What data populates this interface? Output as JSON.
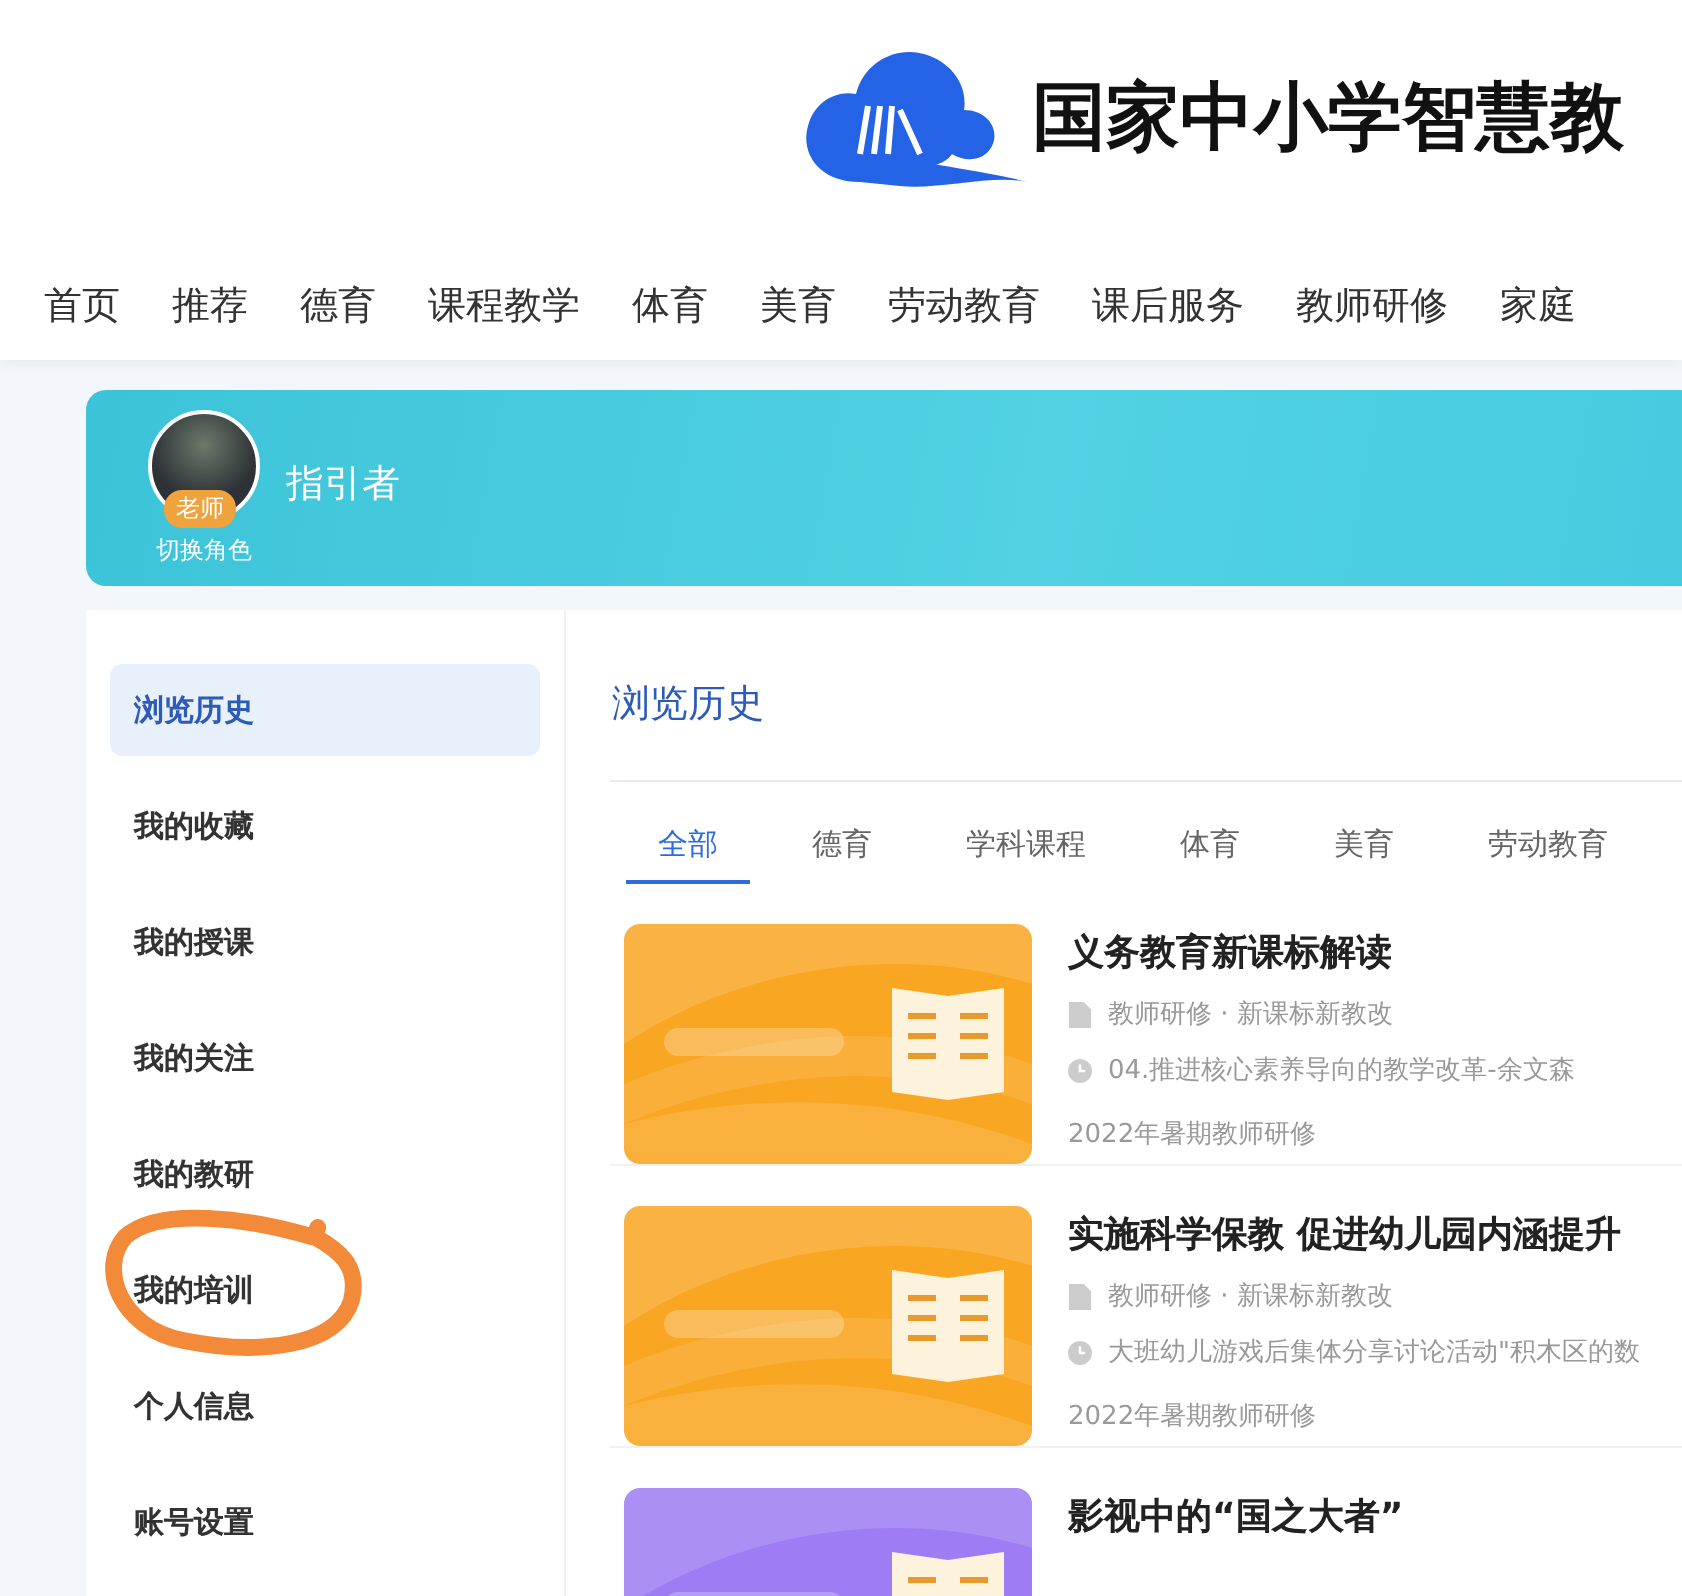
{
  "logo": {
    "title": "国家中小学智慧教"
  },
  "nav": [
    {
      "label": "首页"
    },
    {
      "label": "推荐"
    },
    {
      "label": "德育"
    },
    {
      "label": "课程教学"
    },
    {
      "label": "体育"
    },
    {
      "label": "美育"
    },
    {
      "label": "劳动教育"
    },
    {
      "label": "课后服务"
    },
    {
      "label": "教师研修"
    },
    {
      "label": "家庭"
    }
  ],
  "profile": {
    "name": "指引者",
    "badge": "老师",
    "switch_link": "切换角色"
  },
  "sidebar": {
    "items": [
      {
        "label": "浏览历史",
        "selected": true
      },
      {
        "label": "我的收藏",
        "selected": false
      },
      {
        "label": "我的授课",
        "selected": false
      },
      {
        "label": "我的关注",
        "selected": false
      },
      {
        "label": "我的教研",
        "selected": false
      },
      {
        "label": "我的培训",
        "selected": false
      },
      {
        "label": "个人信息",
        "selected": false
      },
      {
        "label": "账号设置",
        "selected": false
      }
    ]
  },
  "content": {
    "title": "浏览历史",
    "tabs": [
      {
        "label": "全部",
        "selected": true
      },
      {
        "label": "德育",
        "selected": false
      },
      {
        "label": "学科课程",
        "selected": false
      },
      {
        "label": "体育",
        "selected": false
      },
      {
        "label": "美育",
        "selected": false
      },
      {
        "label": "劳动教育",
        "selected": false
      }
    ],
    "items": [
      {
        "kind": "picture",
        "color": "#f9a623",
        "title": "义务教育新课标解读",
        "category": "教师研修 · 新课标新教改",
        "lesson": "04.推进核心素养导向的教学改革-余文森",
        "series": "2022年暑期教师研修"
      },
      {
        "kind": "picture",
        "color": "#f9a623",
        "title": "实施科学保教 促进幼儿园内涵提升",
        "category": "教师研修 · 新课标新教改",
        "lesson": "大班幼儿游戏后集体分享讨论活动\"积木区的数",
        "series": "2022年暑期教师研修"
      },
      {
        "kind": "picture",
        "color": "#9d7cf4",
        "title": "影视中的“国之大者”"
      }
    ]
  }
}
